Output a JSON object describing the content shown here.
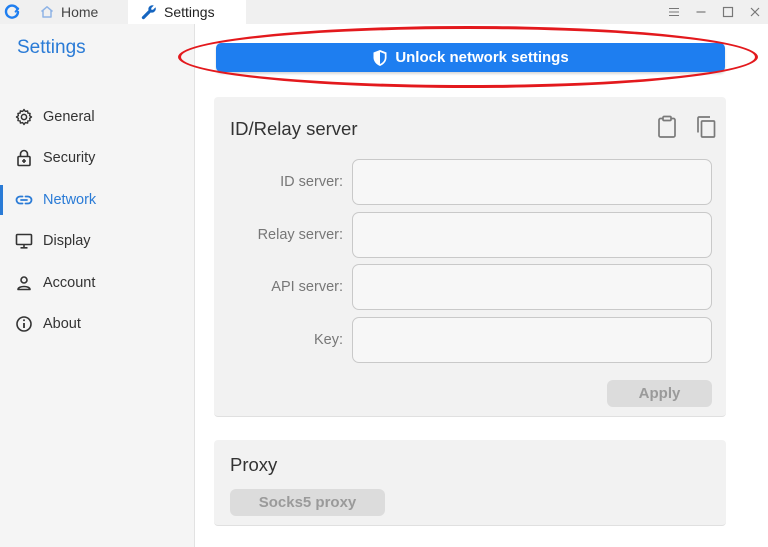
{
  "tabs": [
    {
      "label": "Home",
      "icon": "home-icon"
    },
    {
      "label": "Settings",
      "icon": "wrench-icon",
      "active": true
    }
  ],
  "window_controls": [
    "menu-icon",
    "minimize-icon",
    "maximize-icon",
    "close-icon"
  ],
  "sidebar": {
    "title": "Settings",
    "items": [
      {
        "label": "General",
        "icon": "gear-icon"
      },
      {
        "label": "Security",
        "icon": "lock-icon"
      },
      {
        "label": "Network",
        "icon": "link-icon",
        "active": true
      },
      {
        "label": "Display",
        "icon": "monitor-icon"
      },
      {
        "label": "Account",
        "icon": "person-icon"
      },
      {
        "label": "About",
        "icon": "info-icon"
      }
    ]
  },
  "main": {
    "unlock_button_label": "Unlock network settings",
    "id_relay": {
      "title": "ID/Relay server",
      "fields": [
        {
          "label": "ID server:",
          "value": ""
        },
        {
          "label": "Relay server:",
          "value": ""
        },
        {
          "label": "API server:",
          "value": ""
        },
        {
          "label": "Key:",
          "value": ""
        }
      ],
      "apply_label": "Apply"
    },
    "proxy": {
      "title": "Proxy",
      "button_label": "Socks5 proxy"
    }
  },
  "colors": {
    "accent": "#2a7bd6",
    "unlock_button": "#1e7ef0",
    "highlight": "#e3191d"
  }
}
